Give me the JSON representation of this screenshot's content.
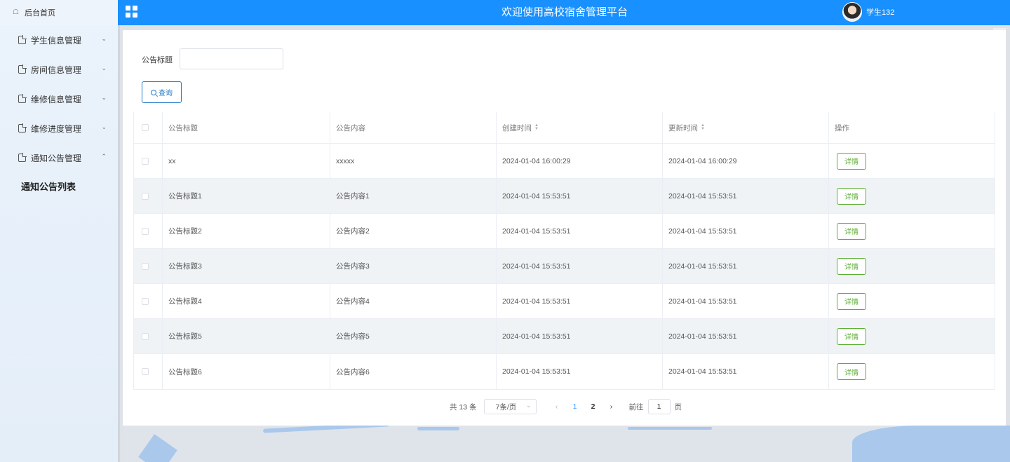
{
  "header": {
    "home_label": "后台首页",
    "title": "欢迎使用高校宿舍管理平台",
    "username": "学生132"
  },
  "sidebar": {
    "items": [
      {
        "label": "学生信息管理",
        "expanded": false
      },
      {
        "label": "房间信息管理",
        "expanded": false
      },
      {
        "label": "维修信息管理",
        "expanded": false
      },
      {
        "label": "维修进度管理",
        "expanded": false
      },
      {
        "label": "通知公告管理",
        "expanded": true
      }
    ],
    "submenu_label": "通知公告列表"
  },
  "search": {
    "label": "公告标题",
    "value": "",
    "placeholder": "",
    "button_label": "查询"
  },
  "table": {
    "headers": [
      "公告标题",
      "公告内容",
      "创建时间",
      "更新时间",
      "操作"
    ],
    "rows": [
      {
        "title": "xx",
        "content": "xxxxx",
        "created": "2024-01-04 16:00:29",
        "updated": "2024-01-04 16:00:29",
        "action": "详情"
      },
      {
        "title": "公告标题1",
        "content": "公告内容1",
        "created": "2024-01-04 15:53:51",
        "updated": "2024-01-04 15:53:51",
        "action": "详情"
      },
      {
        "title": "公告标题2",
        "content": "公告内容2",
        "created": "2024-01-04 15:53:51",
        "updated": "2024-01-04 15:53:51",
        "action": "详情"
      },
      {
        "title": "公告标题3",
        "content": "公告内容3",
        "created": "2024-01-04 15:53:51",
        "updated": "2024-01-04 15:53:51",
        "action": "详情"
      },
      {
        "title": "公告标题4",
        "content": "公告内容4",
        "created": "2024-01-04 15:53:51",
        "updated": "2024-01-04 15:53:51",
        "action": "详情"
      },
      {
        "title": "公告标题5",
        "content": "公告内容5",
        "created": "2024-01-04 15:53:51",
        "updated": "2024-01-04 15:53:51",
        "action": "详情"
      },
      {
        "title": "公告标题6",
        "content": "公告内容6",
        "created": "2024-01-04 15:53:51",
        "updated": "2024-01-04 15:53:51",
        "action": "详情"
      }
    ]
  },
  "pagination": {
    "total_text": "共 13 条",
    "page_size": "7条/页",
    "pages": [
      "1",
      "2"
    ],
    "current_page": "1",
    "goto_label": "前往",
    "goto_value": "1",
    "page_suffix": "页"
  },
  "colors": {
    "header_bg": "#1890ff",
    "primary": "#409eff",
    "success": "#5daf34"
  }
}
